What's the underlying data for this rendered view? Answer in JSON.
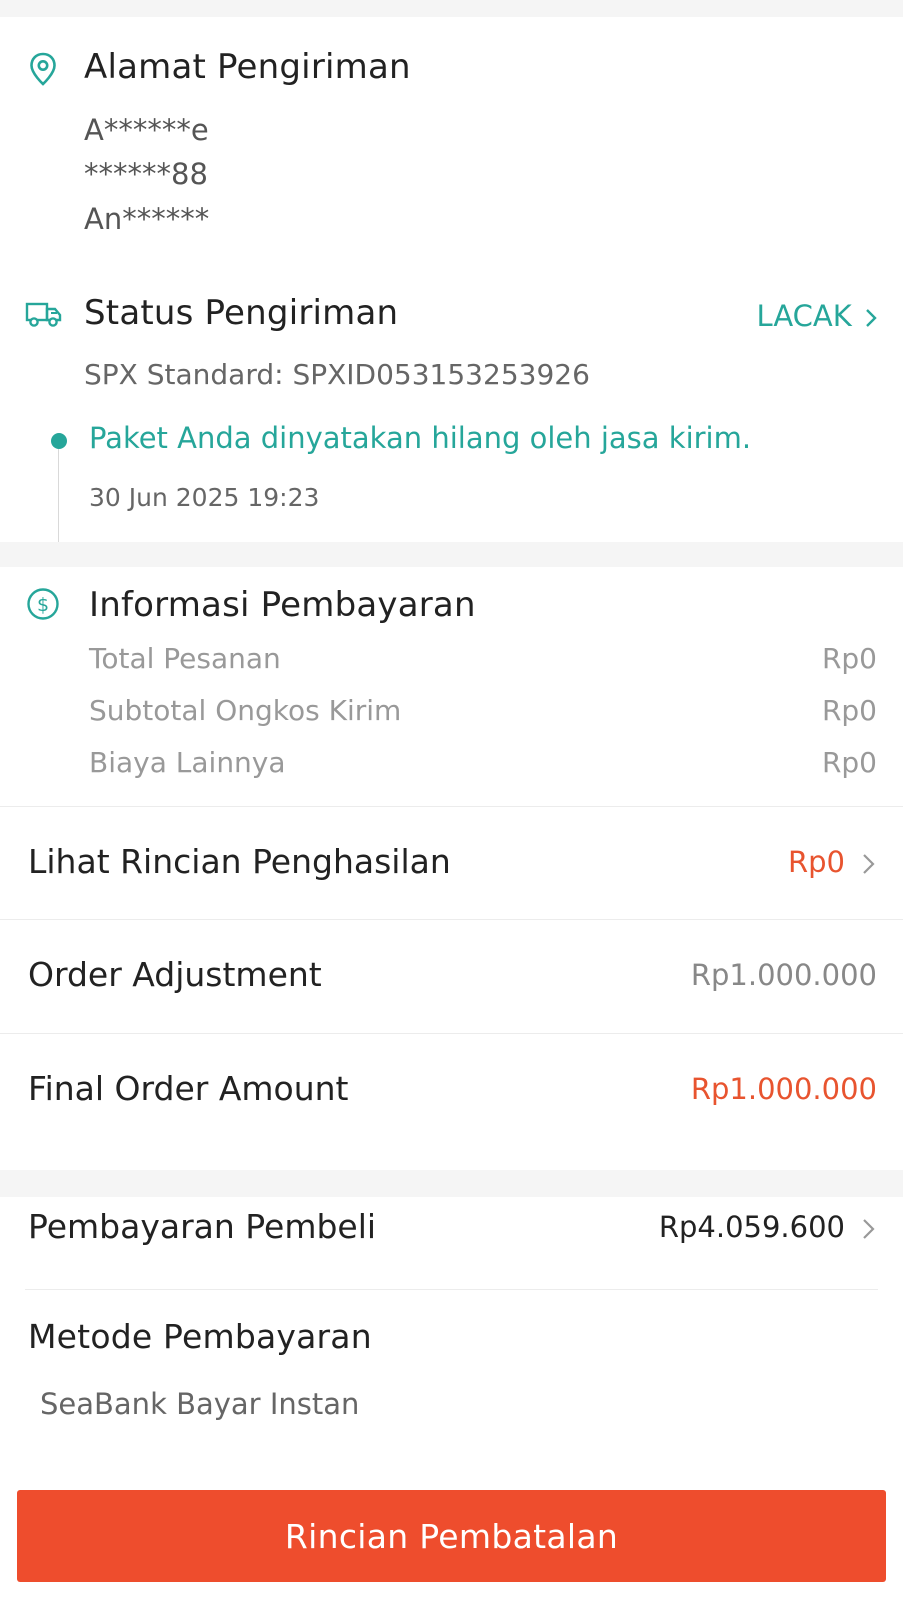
{
  "address": {
    "title": "Alamat Pengiriman",
    "name": "A******e",
    "phone": "******88",
    "street": "An******"
  },
  "shipping": {
    "title": "Status Pengiriman",
    "track_label": "LACAK",
    "service": "SPX Standard: SPXID053153253926",
    "latest_status": "Paket Anda dinyatakan hilang oleh jasa kirim.",
    "latest_time": "30 Jun 2025 19:23"
  },
  "payment_info": {
    "title": "Informasi Pembayaran",
    "rows": [
      {
        "label": "Total Pesanan",
        "value": "Rp0"
      },
      {
        "label": "Subtotal Ongkos Kirim",
        "value": "Rp0"
      },
      {
        "label": "Biaya Lainnya",
        "value": "Rp0"
      }
    ],
    "income_detail": {
      "label": "Lihat Rincian Penghasilan",
      "value": "Rp0"
    },
    "order_adjustment": {
      "label": "Order Adjustment",
      "value": "Rp1.000.000"
    },
    "final_amount": {
      "label": "Final Order Amount",
      "value": "Rp1.000.000"
    }
  },
  "buyer_payment": {
    "label": "Pembayaran Pembeli",
    "value": "Rp4.059.600",
    "method_label": "Metode Pembayaran",
    "method_value": "SeaBank Bayar Instan"
  },
  "bottom": {
    "cancel_detail_label": "Rincian Pembatalan"
  },
  "colors": {
    "accent_teal": "#26a69a",
    "brand_orange": "#ee4d2d",
    "price_orange": "#e8542f"
  },
  "icons": {
    "address": "location-pin-icon",
    "shipping": "truck-icon",
    "payment": "dollar-circle-icon",
    "chevron": "chevron-right-icon"
  }
}
